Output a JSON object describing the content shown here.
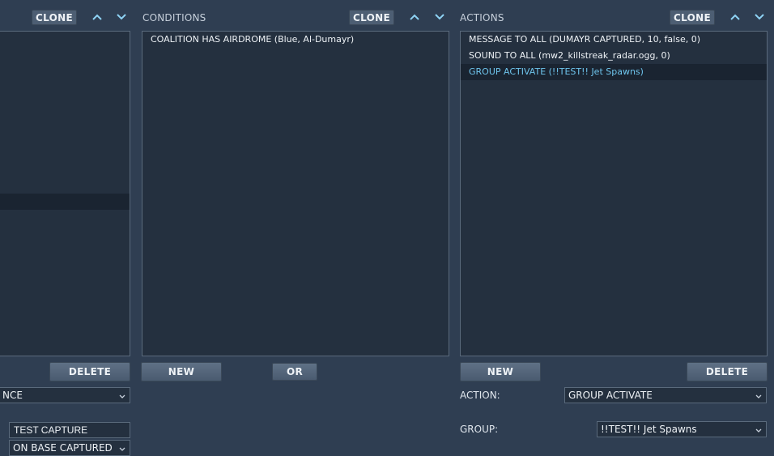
{
  "triggers": {
    "clone_label": "CLONE",
    "delete_label": "DELETE",
    "event_select": "NCE",
    "name_value": "TEST CAPTURE",
    "condition_select": "ON BASE CAPTURED"
  },
  "conditions": {
    "header": "CONDITIONS",
    "clone_label": "CLONE",
    "items": [
      "COALITION HAS AIRDROME (Blue, Al-Dumayr)"
    ],
    "new_label": "NEW",
    "or_label": "OR"
  },
  "actions": {
    "header": "ACTIONS",
    "clone_label": "CLONE",
    "items": [
      "MESSAGE TO ALL (DUMAYR CAPTURED, 10, false, 0)",
      "SOUND TO ALL (mw2_killstreak_radar.ogg, 0)",
      "GROUP ACTIVATE (!!TEST!! Jet Spawns)"
    ],
    "new_label": "NEW",
    "delete_label": "DELETE",
    "action_label": "ACTION:",
    "action_value": "GROUP ACTIVATE",
    "group_label": "GROUP:",
    "group_value": "!!TEST!! Jet Spawns"
  },
  "colors": {
    "background": "#2f3e52",
    "panel": "#24303f",
    "selected_text": "#6ec4ec",
    "arrow": "#8fd3f5"
  },
  "icons": {
    "up": "chevron-up-icon",
    "down": "chevron-down-icon",
    "dropdown": "dropdown-chevron-icon"
  }
}
